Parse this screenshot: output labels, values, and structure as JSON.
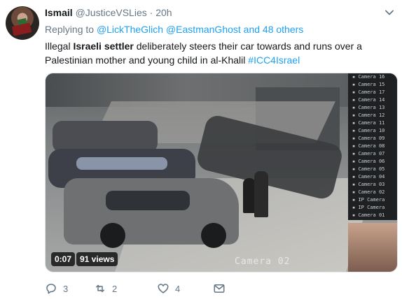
{
  "tweet": {
    "display_name": "Ismail",
    "handle": "@JusticeVSLies",
    "separator": "·",
    "time": "20h",
    "reply_prefix": "Replying to",
    "reply_mention_1": "@LickTheGlich",
    "reply_mention_2": "@EastmanGhost",
    "reply_suffix": "and 48 others",
    "text_1": "Illegal ",
    "text_bold_1": "Israeli settler",
    "text_2": " deliberately steers their car towards and runs over a Palestinian mother and young child in al-Khalil ",
    "hashtag": "#ICC4Israel"
  },
  "video": {
    "duration": "0:07",
    "views": "91 views",
    "overlay_camera_label": "Camera 02",
    "camera_list": [
      "Camera 16",
      "Camera 15",
      "Camera 17",
      "Camera 14",
      "Camera 13",
      "Camera 12",
      "Camera 11",
      "Camera 10",
      "Camera 09",
      "Camera 08",
      "Camera 07",
      "Camera 06",
      "Camera 05",
      "Camera 04",
      "Camera 03",
      "Camera 02",
      "IP Camera",
      "IP Camera",
      "Camera 01"
    ]
  },
  "actions": {
    "reply_count": "3",
    "retweet_count": "2",
    "like_count": "4"
  },
  "colors": {
    "link": "#1da1f2",
    "secondary": "#657786",
    "text": "#14171a"
  }
}
